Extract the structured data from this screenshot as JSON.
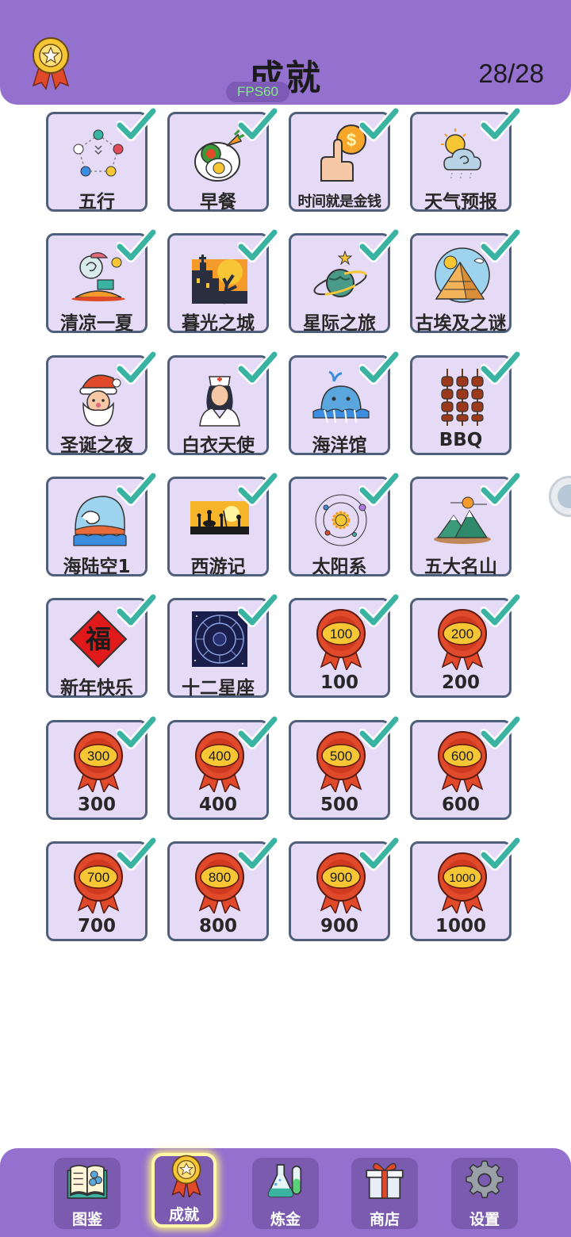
{
  "header": {
    "title": "成就",
    "progress": "28/28",
    "fps": "FPS60",
    "icon": "award-ribbon-icon"
  },
  "achievements": [
    {
      "label": "五行",
      "icon": "five-elements-icon",
      "completed": true
    },
    {
      "label": "早餐",
      "icon": "breakfast-icon",
      "completed": true
    },
    {
      "label": "时间就是金钱",
      "icon": "time-is-money-icon",
      "completed": true
    },
    {
      "label": "天气预报",
      "icon": "weather-forecast-icon",
      "completed": true
    },
    {
      "label": "清凉一夏",
      "icon": "cool-summer-icon",
      "completed": true
    },
    {
      "label": "暮光之城",
      "icon": "twilight-city-icon",
      "completed": true
    },
    {
      "label": "星际之旅",
      "icon": "space-journey-icon",
      "completed": true
    },
    {
      "label": "古埃及之谜",
      "icon": "egypt-pyramid-icon",
      "completed": true
    },
    {
      "label": "圣诞之夜",
      "icon": "santa-icon",
      "completed": true
    },
    {
      "label": "白衣天使",
      "icon": "nurse-icon",
      "completed": true
    },
    {
      "label": "海洋馆",
      "icon": "whale-icon",
      "completed": true
    },
    {
      "label": "BBQ",
      "icon": "skewers-icon",
      "completed": true
    },
    {
      "label": "海陆空1",
      "icon": "sea-land-air-icon",
      "completed": true
    },
    {
      "label": "西游记",
      "icon": "journey-west-icon",
      "completed": true
    },
    {
      "label": "太阳系",
      "icon": "solar-system-icon",
      "completed": true
    },
    {
      "label": "五大名山",
      "icon": "mountains-icon",
      "completed": true
    },
    {
      "label": "新年快乐",
      "icon": "fu-character-icon",
      "completed": true
    },
    {
      "label": "十二星座",
      "icon": "zodiac-icon",
      "completed": true
    },
    {
      "label": "100",
      "icon": "ribbon-medal-icon",
      "badge": "100",
      "completed": true
    },
    {
      "label": "200",
      "icon": "ribbon-medal-icon",
      "badge": "200",
      "completed": true
    },
    {
      "label": "300",
      "icon": "ribbon-medal-icon",
      "badge": "300",
      "completed": true
    },
    {
      "label": "400",
      "icon": "ribbon-medal-icon",
      "badge": "400",
      "completed": true
    },
    {
      "label": "500",
      "icon": "ribbon-medal-icon",
      "badge": "500",
      "completed": true
    },
    {
      "label": "600",
      "icon": "ribbon-medal-icon",
      "badge": "600",
      "completed": true
    },
    {
      "label": "700",
      "icon": "ribbon-medal-icon",
      "badge": "700",
      "completed": true
    },
    {
      "label": "800",
      "icon": "ribbon-medal-icon",
      "badge": "800",
      "completed": true
    },
    {
      "label": "900",
      "icon": "ribbon-medal-icon",
      "badge": "900",
      "completed": true
    },
    {
      "label": "1000",
      "icon": "ribbon-medal-icon",
      "badge": "1000",
      "completed": true
    }
  ],
  "nav": [
    {
      "label": "图鉴",
      "icon": "book-icon",
      "active": false
    },
    {
      "label": "成就",
      "icon": "award-ribbon-icon",
      "active": true
    },
    {
      "label": "炼金",
      "icon": "flask-icon",
      "active": false
    },
    {
      "label": "商店",
      "icon": "gift-icon",
      "active": false
    },
    {
      "label": "设置",
      "icon": "gear-icon",
      "active": false
    }
  ],
  "colors": {
    "primary": "#9470cf",
    "card_bg": "#e6dbf7",
    "card_border": "#50607c",
    "check": "#3bb3a3",
    "medal_red": "#e04a2a",
    "medal_gold": "#f7c634"
  }
}
